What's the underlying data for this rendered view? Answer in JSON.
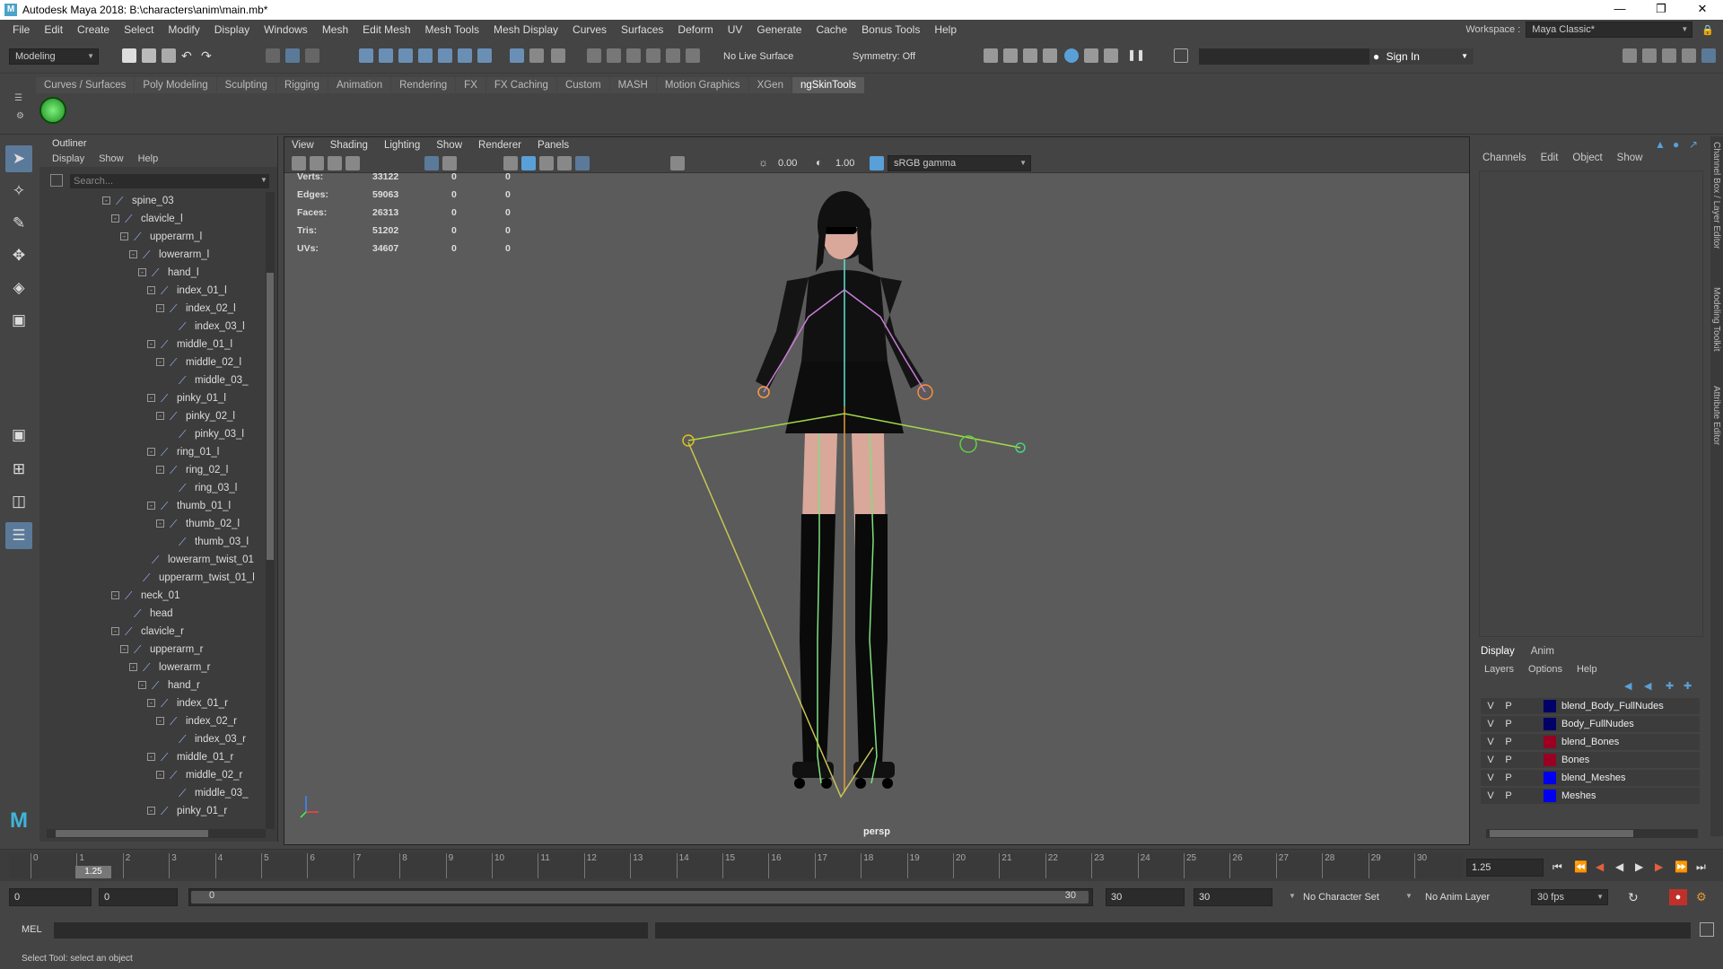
{
  "window": {
    "title": "Autodesk Maya 2018: B:\\characters\\anim\\main.mb*",
    "app_icon": "maya-icon"
  },
  "menus": [
    "File",
    "Edit",
    "Create",
    "Select",
    "Modify",
    "Display",
    "Windows",
    "Mesh",
    "Edit Mesh",
    "Mesh Tools",
    "Mesh Display",
    "Curves",
    "Surfaces",
    "Deform",
    "UV",
    "Generate",
    "Cache",
    "Bonus Tools",
    "Help"
  ],
  "workspace": {
    "label": "Workspace :",
    "value": "Maya Classic*"
  },
  "statusline": {
    "mode": "Modeling",
    "live_surface": "No Live Surface",
    "symmetry": "Symmetry: Off",
    "sign_in": "Sign In"
  },
  "shelf_tabs": [
    "Curves / Surfaces",
    "Poly Modeling",
    "Sculpting",
    "Rigging",
    "Animation",
    "Rendering",
    "FX",
    "FX Caching",
    "Custom",
    "MASH",
    "Motion Graphics",
    "XGen",
    "ngSkinTools"
  ],
  "active_shelf": "ngSkinTools",
  "outliner": {
    "title": "Outliner",
    "menus": [
      "Display",
      "Show",
      "Help"
    ],
    "search_placeholder": "Search...",
    "nodes": [
      {
        "label": "spine_03",
        "depth": 0,
        "exp": "-"
      },
      {
        "label": "clavicle_l",
        "depth": 1,
        "exp": "-"
      },
      {
        "label": "upperarm_l",
        "depth": 2,
        "exp": "-"
      },
      {
        "label": "lowerarm_l",
        "depth": 3,
        "exp": "-"
      },
      {
        "label": "hand_l",
        "depth": 4,
        "exp": "-"
      },
      {
        "label": "index_01_l",
        "depth": 5,
        "exp": "-"
      },
      {
        "label": "index_02_l",
        "depth": 6,
        "exp": "-"
      },
      {
        "label": "index_03_l",
        "depth": 7,
        "exp": ""
      },
      {
        "label": "middle_01_l",
        "depth": 5,
        "exp": "-"
      },
      {
        "label": "middle_02_l",
        "depth": 6,
        "exp": "-"
      },
      {
        "label": "middle_03_",
        "depth": 7,
        "exp": ""
      },
      {
        "label": "pinky_01_l",
        "depth": 5,
        "exp": "-"
      },
      {
        "label": "pinky_02_l",
        "depth": 6,
        "exp": "-"
      },
      {
        "label": "pinky_03_l",
        "depth": 7,
        "exp": ""
      },
      {
        "label": "ring_01_l",
        "depth": 5,
        "exp": "-"
      },
      {
        "label": "ring_02_l",
        "depth": 6,
        "exp": "-"
      },
      {
        "label": "ring_03_l",
        "depth": 7,
        "exp": ""
      },
      {
        "label": "thumb_01_l",
        "depth": 5,
        "exp": "-"
      },
      {
        "label": "thumb_02_l",
        "depth": 6,
        "exp": "-"
      },
      {
        "label": "thumb_03_l",
        "depth": 7,
        "exp": ""
      },
      {
        "label": "lowerarm_twist_01",
        "depth": 4,
        "exp": ""
      },
      {
        "label": "upperarm_twist_01_l",
        "depth": 3,
        "exp": ""
      },
      {
        "label": "neck_01",
        "depth": 1,
        "exp": "-"
      },
      {
        "label": "head",
        "depth": 2,
        "exp": ""
      },
      {
        "label": "clavicle_r",
        "depth": 1,
        "exp": "-"
      },
      {
        "label": "upperarm_r",
        "depth": 2,
        "exp": "-"
      },
      {
        "label": "lowerarm_r",
        "depth": 3,
        "exp": "-"
      },
      {
        "label": "hand_r",
        "depth": 4,
        "exp": "-"
      },
      {
        "label": "index_01_r",
        "depth": 5,
        "exp": "-"
      },
      {
        "label": "index_02_r",
        "depth": 6,
        "exp": "-"
      },
      {
        "label": "index_03_r",
        "depth": 7,
        "exp": ""
      },
      {
        "label": "middle_01_r",
        "depth": 5,
        "exp": "-"
      },
      {
        "label": "middle_02_r",
        "depth": 6,
        "exp": "-"
      },
      {
        "label": "middle_03_",
        "depth": 7,
        "exp": ""
      },
      {
        "label": "pinky_01_r",
        "depth": 5,
        "exp": "-"
      }
    ]
  },
  "viewport": {
    "menus": [
      "View",
      "Shading",
      "Lighting",
      "Show",
      "Renderer",
      "Panels"
    ],
    "exposure": "0.00",
    "gamma": "1.00",
    "color_space": "sRGB gamma",
    "camera": "persp",
    "hud": [
      {
        "label": "Verts:",
        "total": "33122",
        "sel": "0",
        "comp": "0"
      },
      {
        "label": "Edges:",
        "total": "59063",
        "sel": "0",
        "comp": "0"
      },
      {
        "label": "Faces:",
        "total": "26313",
        "sel": "0",
        "comp": "0"
      },
      {
        "label": "Tris:",
        "total": "51202",
        "sel": "0",
        "comp": "0"
      },
      {
        "label": "UVs:",
        "total": "34607",
        "sel": "0",
        "comp": "0"
      }
    ]
  },
  "channel_box": {
    "menus": [
      "Channels",
      "Edit",
      "Object",
      "Show"
    ]
  },
  "layer_editor": {
    "tabs": [
      "Display",
      "Anim"
    ],
    "menus": [
      "Layers",
      "Options",
      "Help"
    ],
    "layers": [
      {
        "v": "V",
        "p": "P",
        "name": "blend_Body_FullNudes",
        "color": "#000066"
      },
      {
        "v": "V",
        "p": "P",
        "name": "Body_FullNudes",
        "color": "#000066"
      },
      {
        "v": "V",
        "p": "P",
        "name": "blend_Bones",
        "color": "#990022"
      },
      {
        "v": "V",
        "p": "P",
        "name": "Bones",
        "color": "#990022"
      },
      {
        "v": "V",
        "p": "P",
        "name": "blend_Meshes",
        "color": "#0000ee"
      },
      {
        "v": "V",
        "p": "P",
        "name": "Meshes",
        "color": "#0000ee"
      }
    ]
  },
  "side_tabs": [
    "Channel Box / Layer Editor",
    "Modeling Toolkit",
    "Attribute Editor"
  ],
  "timeline": {
    "ticks": [
      "0",
      "1",
      "2",
      "3",
      "4",
      "5",
      "6",
      "7",
      "8",
      "9",
      "10",
      "11",
      "12",
      "13",
      "14",
      "15",
      "16",
      "17",
      "18",
      "19",
      "20",
      "21",
      "22",
      "23",
      "24",
      "25",
      "26",
      "27",
      "28",
      "29",
      "30"
    ],
    "current": "1.25",
    "current_field": "1.25"
  },
  "range": {
    "start": "0",
    "anim_start": "0",
    "slider_start": "0",
    "slider_end": "30",
    "anim_end": "30",
    "end": "30",
    "character_set": "No Character Set",
    "anim_layer": "No Anim Layer",
    "fps": "30 fps"
  },
  "command_line": {
    "label": "MEL"
  },
  "help_line": "Select Tool: select an object",
  "colors": {
    "accent": "#5b7a99",
    "viewport_bg": "#5b5b5b",
    "panel": "#444444"
  }
}
